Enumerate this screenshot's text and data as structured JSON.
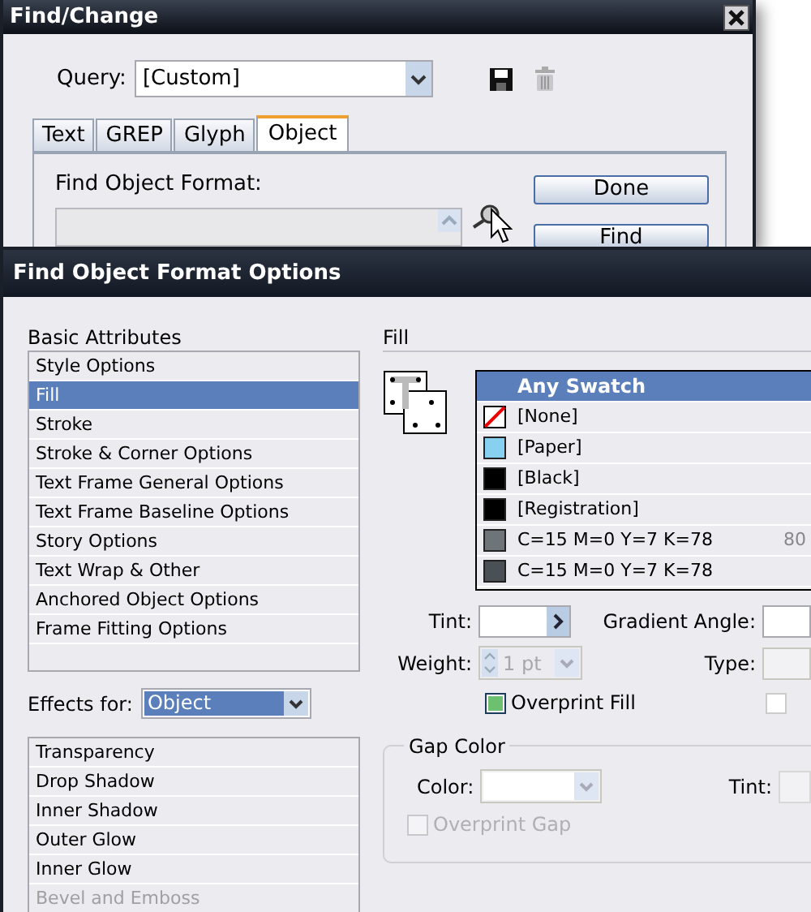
{
  "find_change": {
    "title": "Find/Change",
    "query": {
      "label": "Query:",
      "value": "[Custom]"
    },
    "tabs": [
      {
        "label": "Text",
        "selected": false
      },
      {
        "label": "GREP",
        "selected": false
      },
      {
        "label": "Glyph",
        "selected": false
      },
      {
        "label": "Object",
        "selected": true
      }
    ],
    "find_format_label": "Find Object Format:",
    "buttons": [
      "Done",
      "Find"
    ]
  },
  "options": {
    "title": "Find Object Format Options",
    "basic_attributes": {
      "label": "Basic Attributes",
      "items": [
        {
          "label": "Style Options",
          "selected": false
        },
        {
          "label": "Fill",
          "selected": true
        },
        {
          "label": "Stroke",
          "selected": false
        },
        {
          "label": "Stroke & Corner Options",
          "selected": false
        },
        {
          "label": "Text Frame General Options",
          "selected": false
        },
        {
          "label": "Text Frame Baseline Options",
          "selected": false
        },
        {
          "label": "Story Options",
          "selected": false
        },
        {
          "label": "Text Wrap & Other",
          "selected": false
        },
        {
          "label": "Anchored Object Options",
          "selected": false
        },
        {
          "label": "Frame Fitting Options",
          "selected": false
        }
      ]
    },
    "effects_for": {
      "label": "Effects for:",
      "value": "Object"
    },
    "effects": [
      {
        "label": "Transparency",
        "disabled": false
      },
      {
        "label": "Drop Shadow",
        "disabled": false
      },
      {
        "label": "Inner Shadow",
        "disabled": false
      },
      {
        "label": "Outer Glow",
        "disabled": false
      },
      {
        "label": "Inner Glow",
        "disabled": false
      },
      {
        "label": "Bevel and Emboss",
        "disabled": true
      }
    ],
    "fill": {
      "heading": "Fill",
      "swatches": [
        {
          "kind": "any",
          "name": "Any Swatch",
          "selected": true
        },
        {
          "kind": "none",
          "name": "[None]",
          "selected": false
        },
        {
          "kind": "color",
          "name": "[Paper]",
          "color": "#88d0f0",
          "selected": false
        },
        {
          "kind": "color",
          "name": "[Black]",
          "color": "#000000",
          "selected": false
        },
        {
          "kind": "color",
          "name": "[Registration]",
          "color": "#000000",
          "selected": false
        },
        {
          "kind": "color",
          "name": "C=15 M=0 Y=7 K=78",
          "color": "#6e7478",
          "tint": "80",
          "selected": false
        },
        {
          "kind": "color",
          "name": "C=15 M=0 Y=7 K=78",
          "color": "#4a5055",
          "selected": false
        }
      ],
      "tint": {
        "label": "Tint:"
      },
      "gradient_angle": {
        "label": "Gradient Angle:"
      },
      "weight": {
        "label": "Weight:",
        "value": "1 pt",
        "disabled": true
      },
      "type": {
        "label": "Type:"
      },
      "overprint_fill": {
        "label": "Overprint Fill",
        "checked": true
      },
      "checkbox_2": {
        "checked": false
      }
    },
    "gap_color": {
      "title": "Gap Color",
      "color_label": "Color:",
      "tint_label": "Tint:",
      "overprint_gap": {
        "label": "Overprint Gap",
        "checked": false,
        "disabled": true
      }
    }
  }
}
